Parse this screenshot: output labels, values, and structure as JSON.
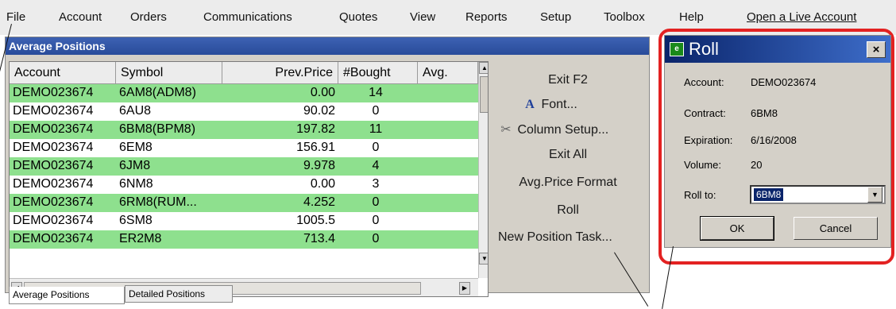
{
  "menu": [
    "File",
    "Account",
    "Orders",
    "Communications",
    "Quotes",
    "View",
    "Reports",
    "Setup",
    "Toolbox",
    "Help",
    "Open a Live Account"
  ],
  "avg_window": {
    "title": "Average Positions",
    "columns": [
      "Account",
      "Symbol",
      "Prev.Price",
      "#Bought",
      "Avg."
    ],
    "rows": [
      {
        "account": "DEMO023674",
        "symbol": "6AM8(ADM8)",
        "prev": "0.00",
        "bought": "14",
        "highlight": true
      },
      {
        "account": "DEMO023674",
        "symbol": "6AU8",
        "prev": "90.02",
        "bought": "0",
        "highlight": false
      },
      {
        "account": "DEMO023674",
        "symbol": "6BM8(BPM8)",
        "prev": "197.82",
        "bought": "11",
        "highlight": true
      },
      {
        "account": "DEMO023674",
        "symbol": "6EM8",
        "prev": "156.91",
        "bought": "0",
        "highlight": false
      },
      {
        "account": "DEMO023674",
        "symbol": "6JM8",
        "prev": "9.978",
        "bought": "4",
        "highlight": true
      },
      {
        "account": "DEMO023674",
        "symbol": "6NM8",
        "prev": "0.00",
        "bought": "3",
        "highlight": false
      },
      {
        "account": "DEMO023674",
        "symbol": "6RM8(RUM...",
        "prev": "4.252",
        "bought": "0",
        "highlight": true
      },
      {
        "account": "DEMO023674",
        "symbol": "6SM8",
        "prev": "1005.5",
        "bought": "0",
        "highlight": false
      },
      {
        "account": "DEMO023674",
        "symbol": "ER2M8",
        "prev": "713.4",
        "bought": "0",
        "highlight": true
      }
    ],
    "actions": {
      "exit_f2": "Exit F2",
      "font": "Font...",
      "font_icon": "A",
      "column_setup": "Column Setup...",
      "exit_all": "Exit All",
      "avg_price_format": "Avg.Price Format",
      "roll": "Roll",
      "new_position_task": "New Position Task..."
    },
    "tabs": [
      "Average Positions",
      "Detailed Positions"
    ]
  },
  "roll_dialog": {
    "title": "Roll",
    "close": "×",
    "fields": {
      "account_label": "Account:",
      "account_value": "DEMO023674",
      "contract_label": "Contract:",
      "contract_value": "6BM8",
      "expiration_label": "Expiration:",
      "expiration_value": "6/16/2008",
      "volume_label": "Volume:",
      "volume_value": "20",
      "roll_to_label": "Roll to:",
      "roll_to_value": "6BM8"
    },
    "ok": "OK",
    "cancel": "Cancel"
  },
  "colors": {
    "row_highlight": "#8ee08e",
    "title_bar": "#294c9a",
    "dialog_title": "#0a246a",
    "callout_outline": "#e32222"
  }
}
